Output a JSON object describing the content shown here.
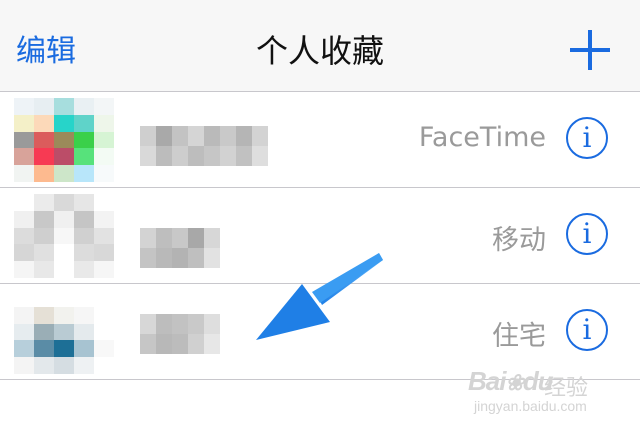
{
  "navbar": {
    "edit_label": "编辑",
    "title": "个人收藏",
    "add_icon": "plus-icon"
  },
  "contacts": [
    {
      "label": "FaceTime",
      "info_glyph": "i",
      "info_icon": "info-icon"
    },
    {
      "label": "移动",
      "info_glyph": "i",
      "info_icon": "info-icon"
    },
    {
      "label": "住宅",
      "info_glyph": "i",
      "info_icon": "info-icon"
    }
  ],
  "colors": {
    "accent": "#1a6be0",
    "annotation_arrow": "#2f95f0",
    "secondary_text": "#9a9a9a",
    "separator": "#c8c7cc"
  },
  "watermark": {
    "logo": "Bai",
    "logo_suffix": "du",
    "text": "经验",
    "url": "jingyan.baidu.com"
  }
}
